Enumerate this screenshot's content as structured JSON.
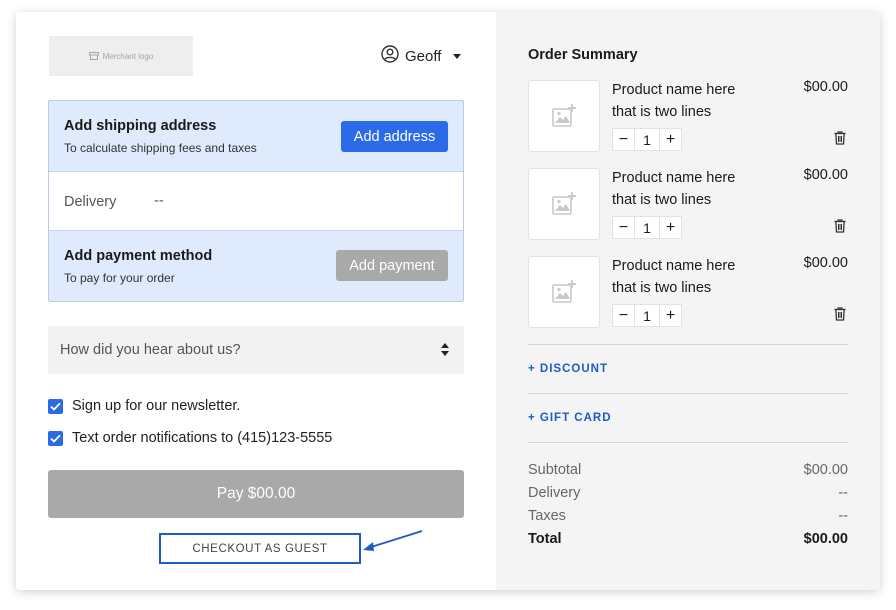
{
  "header": {
    "logo_text": "Merchant logo",
    "user_name": "Geoff"
  },
  "shipping": {
    "title": "Add shipping address",
    "subtitle": "To calculate shipping fees and taxes",
    "button_label": "Add address"
  },
  "delivery": {
    "label": "Delivery",
    "value": "--"
  },
  "payment": {
    "title": "Add payment method",
    "subtitle": "To pay for your order",
    "button_label": "Add payment"
  },
  "referral_select": {
    "placeholder": "How did you hear about us?"
  },
  "checkboxes": [
    {
      "label": "Sign up for our newsletter.",
      "checked": true
    },
    {
      "label": "Text order notifications to (415)123-5555",
      "checked": true
    }
  ],
  "pay_button_label": "Pay $00.00",
  "guest_button_label": "CHECKOUT AS GUEST",
  "order_summary": {
    "title": "Order Summary",
    "items": [
      {
        "name": "Product name here that is two lines",
        "price": "$00.00",
        "quantity": "1"
      },
      {
        "name": "Product name here that is two lines",
        "price": "$00.00",
        "quantity": "1"
      },
      {
        "name": "Product name here that is two lines",
        "price": "$00.00",
        "quantity": "1"
      }
    ],
    "discount_label": "+ DISCOUNT",
    "gift_card_label": "+ GIFT CARD",
    "subtotal_label": "Subtotal",
    "subtotal_value": "$00.00",
    "delivery_label": "Delivery",
    "delivery_value": "--",
    "taxes_label": "Taxes",
    "taxes_value": "--",
    "total_label": "Total",
    "total_value": "$00.00"
  },
  "colors": {
    "accent": "#2b6be8",
    "link": "#1e5ac8",
    "disabled_button": "#a9a9a9",
    "info_background": "#dfeafc",
    "summary_background": "#f4f4f4"
  },
  "icons": {
    "logo": "store-icon",
    "user": "user-circle-icon",
    "dropdown": "caret-down-icon",
    "select": "select-arrows-icon",
    "checkbox": "checkmark-icon",
    "product_thumb": "add-image-icon",
    "remove": "trash-icon",
    "annotation": "arrow-icon"
  }
}
